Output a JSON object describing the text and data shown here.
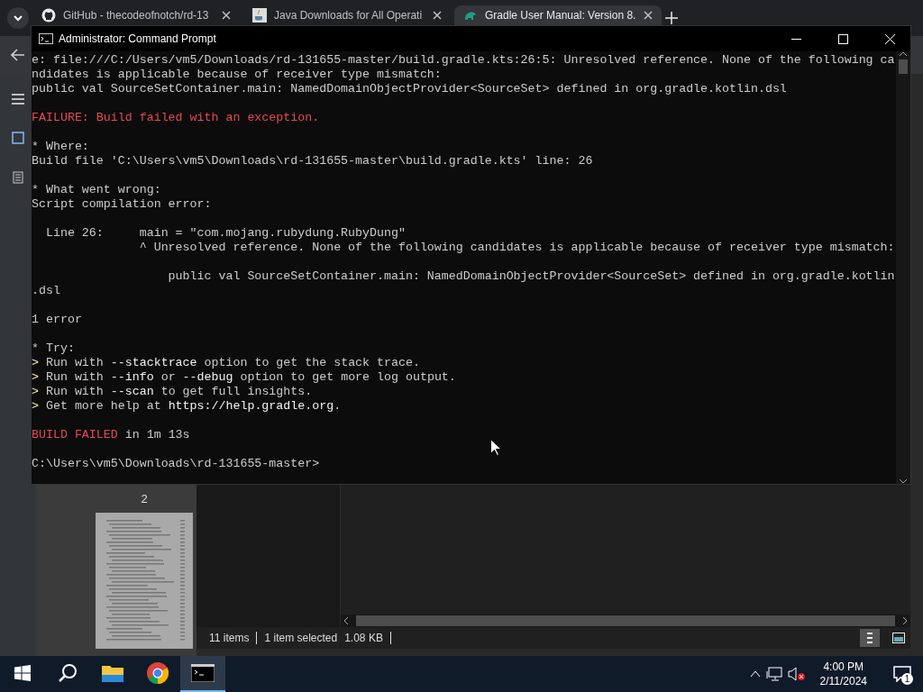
{
  "browser": {
    "tabs": [
      {
        "title": "GitHub - thecodeofnotch/rd-13",
        "kind": "github",
        "selected": false
      },
      {
        "title": "Java Downloads for All Operati",
        "kind": "java",
        "selected": false
      },
      {
        "title": "Gradle User Manual: Version 8.",
        "kind": "gradle",
        "selected": true
      }
    ],
    "sidebar": {
      "page_number": "2"
    }
  },
  "console": {
    "title": "Administrator: Command Prompt",
    "blocks": [
      [
        {
          "kind": "plain",
          "text": "e: file:///C:/Users/vm5/Downloads/rd-131655-master/build.gradle.kts:26:5: Unresolved reference. None of the following ca"
        },
        {
          "kind": "plain",
          "text": "ndidates is applicable because of receiver type mismatch:"
        },
        {
          "kind": "plain",
          "text": "public val SourceSetContainer.main: NamedDomainObjectProvider<SourceSet> defined in org.gradle.kotlin.dsl"
        }
      ],
      [
        {
          "kind": "error",
          "text": "FAILURE: Build failed with an exception."
        }
      ],
      [
        {
          "kind": "plain",
          "text": "* Where:"
        },
        {
          "kind": "plain",
          "text": "Build file 'C:\\Users\\vm5\\Downloads\\rd-131655-master\\build.gradle.kts' line: 26"
        }
      ],
      [
        {
          "kind": "plain",
          "text": "* What went wrong:"
        },
        {
          "kind": "plain",
          "text": "Script compilation error:"
        }
      ],
      [
        {
          "kind": "plain",
          "text": "  Line 26:     main = \"com.mojang.rubydung.RubyDung\""
        },
        {
          "kind": "plain",
          "text": "               ^ Unresolved reference. None of the following candidates is applicable because of receiver type mismatch:"
        }
      ],
      [
        {
          "kind": "plain",
          "text": "                   public val SourceSetContainer.main: NamedDomainObjectProvider<SourceSet> defined in org.gradle.kotlin"
        },
        {
          "kind": "plain",
          "text": ".dsl"
        }
      ],
      [
        {
          "kind": "plain",
          "text": "1 error"
        }
      ],
      [
        {
          "kind": "plain",
          "text": "* Try:"
        },
        {
          "kind": "hint",
          "marker": ">",
          "text": "Run with **--stacktrace** option to get the stack trace."
        },
        {
          "kind": "hint",
          "marker": ">",
          "text": "Run with **--info** or **--debug** option to get more log output."
        },
        {
          "kind": "hint",
          "marker": ">",
          "text": "Run with **--scan** to get full insights."
        },
        {
          "kind": "hint",
          "marker": ">",
          "text": "Get more help at **https://help.gradle.org**."
        }
      ],
      [
        {
          "kind": "status",
          "label": "BUILD FAILED",
          "text": "in 1m 13s"
        }
      ],
      [
        {
          "kind": "plain",
          "text": "C:\\Users\\vm5\\Downloads\\rd-131655-master>"
        }
      ]
    ]
  },
  "explorer": {
    "count": "11 items",
    "selection": "1 item selected",
    "size": "1.08 KB"
  },
  "taskbar": {
    "apps": [
      {
        "kind": "explorer",
        "selected": false
      },
      {
        "kind": "chrome",
        "selected": false
      },
      {
        "kind": "terminal",
        "selected": true
      }
    ],
    "time": "4:00 PM",
    "date": "2/11/2024",
    "notifications": "1"
  }
}
